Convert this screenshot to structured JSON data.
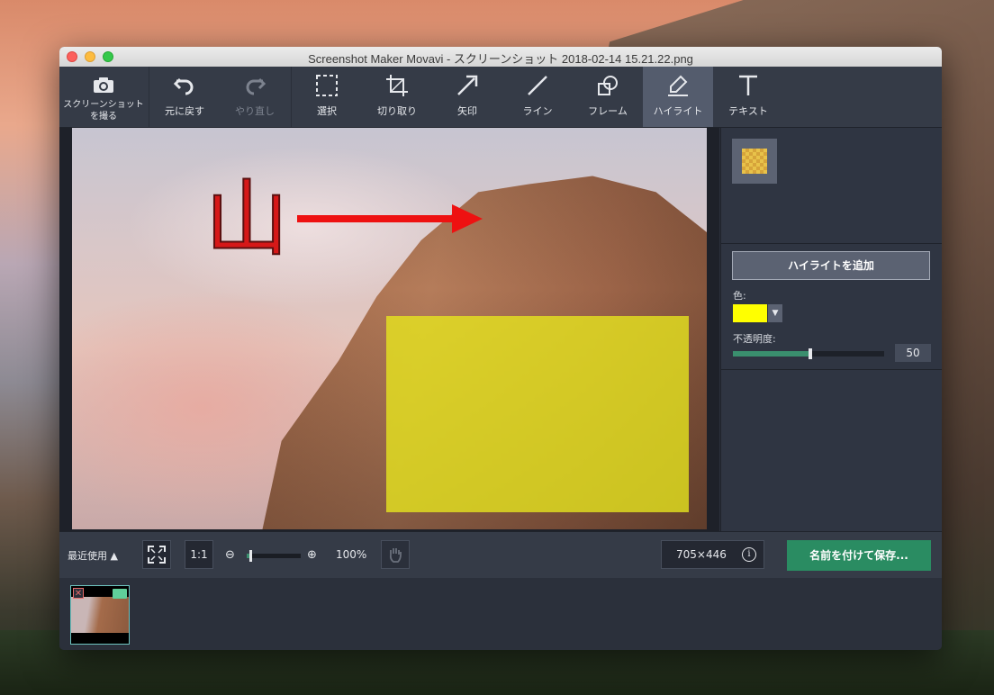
{
  "window": {
    "title": "Screenshot Maker Movavi - スクリーンショット 2018-02-14 15.21.22.png"
  },
  "toolbar": {
    "items": [
      {
        "label_line1": "スクリーンショット",
        "label_line2": "を撮る",
        "icon": "camera-icon"
      },
      {
        "label": "元に戻す",
        "icon": "undo-icon"
      },
      {
        "label": "やり直し",
        "icon": "redo-icon"
      },
      {
        "label": "選択",
        "icon": "select-icon"
      },
      {
        "label": "切り取り",
        "icon": "crop-icon"
      },
      {
        "label": "矢印",
        "icon": "arrow-icon"
      },
      {
        "label": "ライン",
        "icon": "line-icon"
      },
      {
        "label": "フレーム",
        "icon": "frame-icon"
      },
      {
        "label": "ハイライト",
        "icon": "highlight-icon",
        "active": true
      },
      {
        "label": "テキスト",
        "icon": "text-icon"
      }
    ]
  },
  "canvas": {
    "annotation_text": "山",
    "arrow_color": "#ee1111",
    "highlight_color": "#e8e81e"
  },
  "side_panel": {
    "add_button_label": "ハイライトを追加",
    "color_label": "色:",
    "color_value": "#ffff00",
    "opacity_label": "不透明度:",
    "opacity_value": "50",
    "opacity_fraction": 0.5
  },
  "bottom_bar": {
    "recent_label": "最近使用 ▲",
    "one_to_one_label": "1:1",
    "zoom_minus": "⊖",
    "zoom_plus": "⊕",
    "zoom_value": "100%",
    "image_size": "705×446",
    "info_glyph": "i",
    "save_button_label": "名前を付けて保存..."
  },
  "colors": {
    "accent_green": "#2a8c62",
    "toolbar_bg": "#353b47",
    "active_tool_bg": "#545c6d"
  }
}
